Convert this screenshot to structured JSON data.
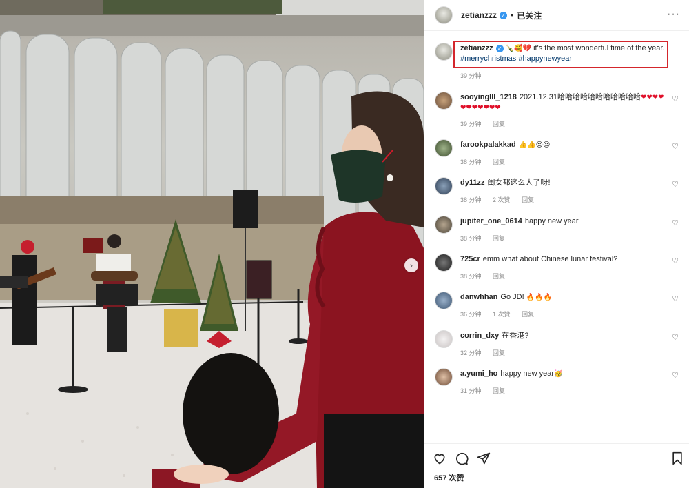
{
  "post": {
    "username": "zetianzzz",
    "follow_status": "已关注",
    "more_icon": "more-horizontal-icon"
  },
  "caption": {
    "username": "zetianzzz",
    "emojis": "🍾🥰💔",
    "text": "it's the most wonderful time of the year.",
    "hashtags": "#merrychristmas #happynewyear",
    "time": "39 分钟"
  },
  "comments": [
    {
      "username": "sooyinglll_1218",
      "text": "2021.12.31哈哈哈哈哈哈哈哈哈哈哈",
      "emojis": "❤❤❤❤❤❤❤❤❤❤❤",
      "time": "39 分钟",
      "likes": "",
      "reply": "回复"
    },
    {
      "username": "farookpalakkad",
      "text": "",
      "emojis": "👍👍😍😍",
      "time": "38 分钟",
      "likes": "",
      "reply": "回复"
    },
    {
      "username": "dy11zz",
      "text": "闺女都这么大了呀!",
      "emojis": "",
      "time": "38 分钟",
      "likes": "2 次赞",
      "reply": "回复"
    },
    {
      "username": "jupiter_one_0614",
      "text": "happy new year",
      "emojis": "",
      "time": "38 分钟",
      "likes": "",
      "reply": "回复"
    },
    {
      "username": "725cr",
      "text": "emm what about Chinese lunar festival?",
      "emojis": "",
      "time": "38 分钟",
      "likes": "",
      "reply": "回复"
    },
    {
      "username": "danwhhan",
      "text": "Go JD!",
      "emojis": "🔥🔥🔥",
      "time": "36 分钟",
      "likes": "1 次赞",
      "reply": "回复"
    },
    {
      "username": "corrin_dxy",
      "text": "在香港?",
      "emojis": "",
      "time": "32 分钟",
      "likes": "",
      "reply": "回复"
    },
    {
      "username": "a.yumi_ho",
      "text": "happy new year",
      "emojis": "🥳",
      "time": "31 分钟",
      "likes": "",
      "reply": "回复"
    }
  ],
  "footer": {
    "likes": "657 次赞",
    "icons": [
      "heart-icon",
      "comment-icon",
      "share-icon",
      "bookmark-icon"
    ]
  },
  "colors": {
    "highlight_box": "#d4262c",
    "hashtag": "#00376b",
    "verified": "#3897f0",
    "meta_gray": "#8e8e8e"
  }
}
